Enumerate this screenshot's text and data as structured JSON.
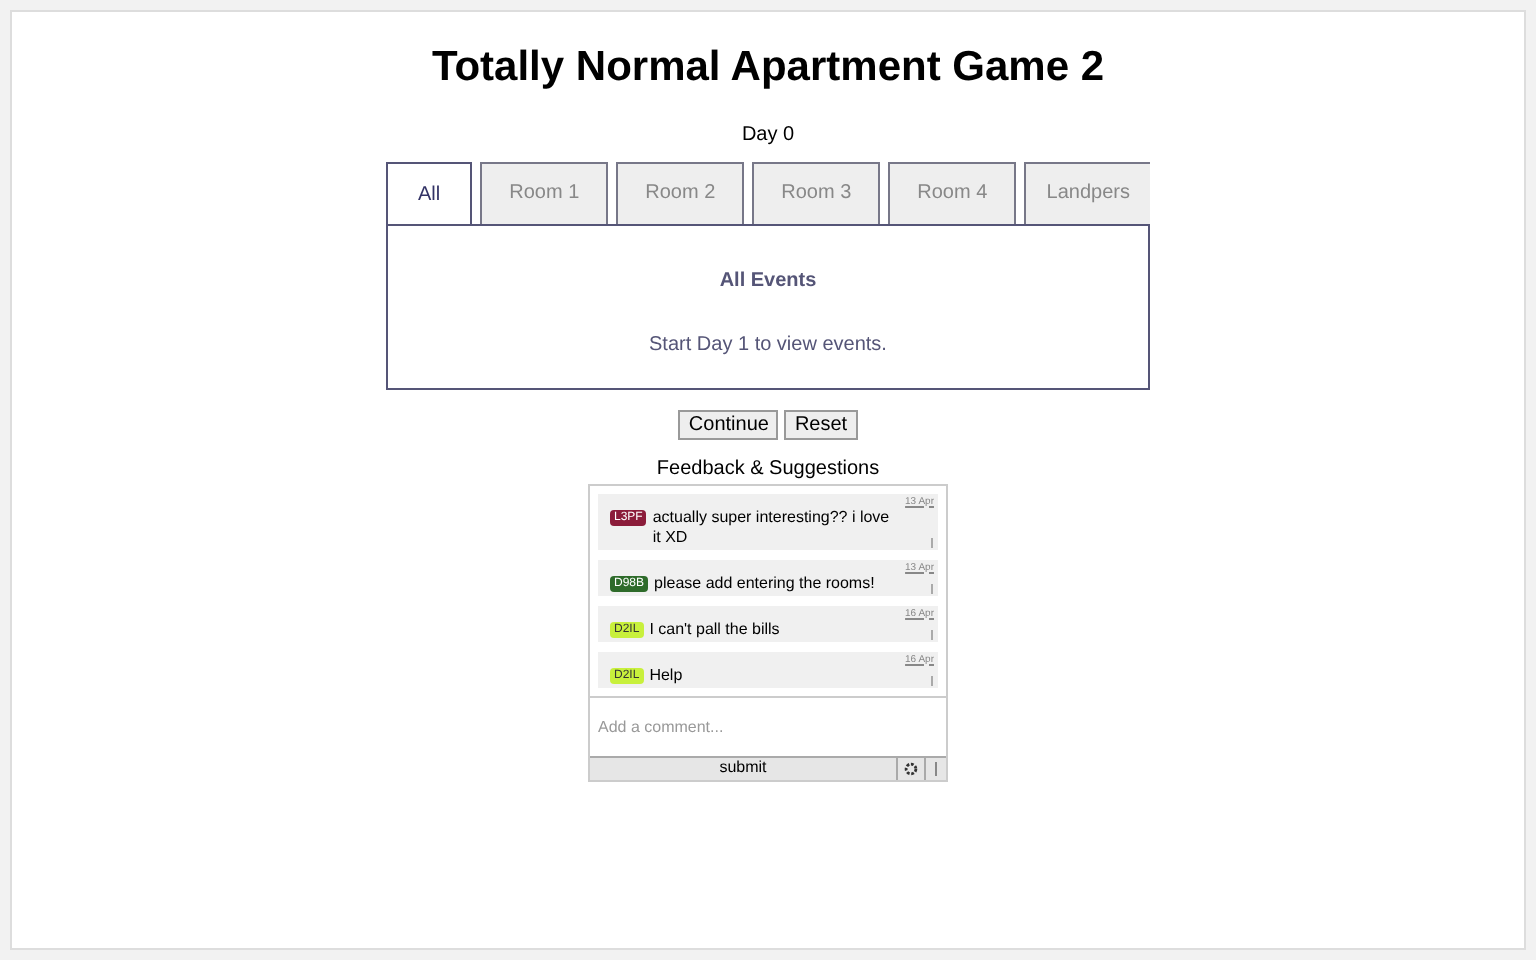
{
  "title": "Totally Normal Apartment Game 2",
  "day": "Day 0",
  "tabs": [
    {
      "label": "All",
      "selected": true
    },
    {
      "label": "Room 1",
      "selected": false
    },
    {
      "label": "Room 2",
      "selected": false
    },
    {
      "label": "Room 3",
      "selected": false
    },
    {
      "label": "Room 4",
      "selected": false
    },
    {
      "label": "Landpers",
      "selected": false
    }
  ],
  "panel": {
    "heading": "All Events",
    "message": "Start Day 1 to view events."
  },
  "buttons": [
    "Continue",
    "Reset"
  ],
  "feedback": {
    "title": "Feedback & Suggestions",
    "comments": [
      {
        "tag": "L3PF",
        "color": "#8b1c3a",
        "text": "actually super interesting?? i love it XD",
        "date": "13 Apr"
      },
      {
        "tag": "D98B",
        "color": "#2e6b2a",
        "text": "please add entering the rooms!",
        "date": "13 Apr"
      },
      {
        "tag": "D2IL",
        "color": "#c8f03c",
        "text": "I can't pall the bills",
        "date": "16 Apr"
      },
      {
        "tag": "D2IL",
        "color": "#c8f03c",
        "text": "Help",
        "date": "16 Apr"
      }
    ],
    "placeholder": "Add a comment...",
    "submit": "submit"
  }
}
